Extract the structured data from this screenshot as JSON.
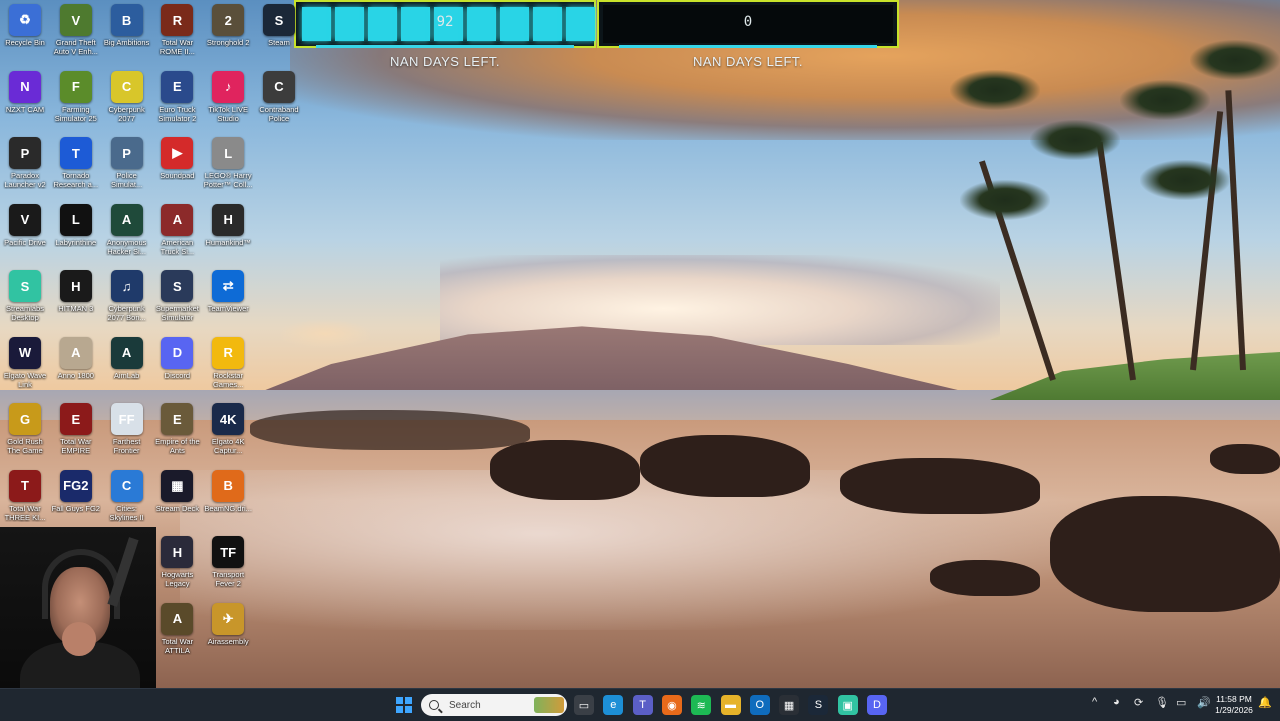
{
  "widgets": [
    {
      "value": "92",
      "label": "NAN DAYS LEFT.",
      "segments": 9
    },
    {
      "value": "0",
      "label": "NAN DAYS LEFT.",
      "segments": 0
    }
  ],
  "desktop_icons": [
    {
      "label": "Recycle Bin",
      "icon": "recycle-bin-icon",
      "color": "#3b6fd6",
      "glyph": "♻"
    },
    {
      "label": "Grand Theft Auto V Enh...",
      "icon": "gta-icon",
      "color": "#4e7a2f",
      "glyph": "V"
    },
    {
      "label": "Big Ambitions",
      "icon": "big-ambitions-icon",
      "color": "#2c5d9e",
      "glyph": "B"
    },
    {
      "label": "Total War ROME II...",
      "icon": "total-war-rome-icon",
      "color": "#7a2a1a",
      "glyph": "R"
    },
    {
      "label": "Stronghold 2",
      "icon": "stronghold-icon",
      "color": "#5a4f3a",
      "glyph": "2"
    },
    {
      "label": "Steam",
      "icon": "steam-icon",
      "color": "#1b2838",
      "glyph": "S"
    },
    {
      "label": "NZXT CAM",
      "icon": "nzxt-cam-icon",
      "color": "#6a2bd6",
      "glyph": "N"
    },
    {
      "label": "Farming Simulator 25",
      "icon": "farming-sim-icon",
      "color": "#5b8c2a",
      "glyph": "F"
    },
    {
      "label": "Cyberpunk 2077",
      "icon": "cyberpunk-icon",
      "color": "#d8c62a",
      "glyph": "C"
    },
    {
      "label": "Euro Truck Simulator 2",
      "icon": "euro-truck-icon",
      "color": "#2a4a8c",
      "glyph": "E"
    },
    {
      "label": "TikTok LIVE Studio",
      "icon": "tiktok-icon",
      "color": "#e0245e",
      "glyph": "♪"
    },
    {
      "label": "Contraband Police",
      "icon": "contraband-icon",
      "color": "#3c3c3c",
      "glyph": "C"
    },
    {
      "label": "Paradox Launcher v2",
      "icon": "paradox-icon",
      "color": "#2a2a2a",
      "glyph": "P"
    },
    {
      "label": "Tornado Research a...",
      "icon": "tornado-icon",
      "color": "#1d5bd6",
      "glyph": "T"
    },
    {
      "label": "Police Simulat...",
      "icon": "police-sim-icon",
      "color": "#4a6a8c",
      "glyph": "P"
    },
    {
      "label": "Soundpad",
      "icon": "soundpad-icon",
      "color": "#d42a2a",
      "glyph": "▶"
    },
    {
      "label": "LEGO® Harry Potter™ Coll...",
      "icon": "lego-hp-icon",
      "color": "#8a8a8a",
      "glyph": "L"
    },
    {
      "label": "Pacific Drive",
      "icon": "pacific-drive-icon",
      "color": "#1a1a1a",
      "glyph": "V"
    },
    {
      "label": "Labyrinthine",
      "icon": "labyrinthine-icon",
      "color": "#111111",
      "glyph": "L"
    },
    {
      "label": "Anonymous Hacker Si...",
      "icon": "hacker-sim-icon",
      "color": "#1f4a3a",
      "glyph": "A"
    },
    {
      "label": "American Truck Si...",
      "icon": "american-truck-icon",
      "color": "#8c2a2a",
      "glyph": "A"
    },
    {
      "label": "Humankind™",
      "icon": "humankind-icon",
      "color": "#2a2a2a",
      "glyph": "H"
    },
    {
      "label": "Streamlabs Desktop",
      "icon": "streamlabs-icon",
      "color": "#31c3a2",
      "glyph": "S"
    },
    {
      "label": "HITMAN 3",
      "icon": "hitman-icon",
      "color": "#1a1a1a",
      "glyph": "H"
    },
    {
      "label": "Cyberpunk 2077 Bon...",
      "icon": "cyberpunk-bonus-icon",
      "color": "#1f3a6a",
      "glyph": "♫"
    },
    {
      "label": "Supermarket Simulator",
      "icon": "supermarket-icon",
      "color": "#2a3a5a",
      "glyph": "S"
    },
    {
      "label": "TeamViewer",
      "icon": "teamviewer-icon",
      "color": "#0e6bd6",
      "glyph": "⇄"
    },
    {
      "label": "Elgato Wave Link",
      "icon": "elgato-wave-icon",
      "color": "#1a1a3a",
      "glyph": "W"
    },
    {
      "label": "Anno 1800",
      "icon": "anno-icon",
      "color": "#b8a890",
      "glyph": "A"
    },
    {
      "label": "AimLab",
      "icon": "aimlab-icon",
      "color": "#1a3a3a",
      "glyph": "A"
    },
    {
      "label": "Discord",
      "icon": "discord-icon",
      "color": "#5865f2",
      "glyph": "D"
    },
    {
      "label": "Rockstar Games...",
      "icon": "rockstar-icon",
      "color": "#f2b90e",
      "glyph": "R"
    },
    {
      "label": "Gold Rush The Game",
      "icon": "gold-rush-icon",
      "color": "#c89a1a",
      "glyph": "G"
    },
    {
      "label": "Total War EMPIRE",
      "icon": "total-war-empire-icon",
      "color": "#8c1a1a",
      "glyph": "E"
    },
    {
      "label": "Farthest Frontier",
      "icon": "farthest-frontier-icon",
      "color": "#d8e0e8",
      "glyph": "FF"
    },
    {
      "label": "Empire of the Ants",
      "icon": "empire-ants-icon",
      "color": "#6a5a3a",
      "glyph": "E"
    },
    {
      "label": "Elgato 4K Captur...",
      "icon": "elgato-4k-icon",
      "color": "#1a2a4a",
      "glyph": "4K"
    },
    {
      "label": "Total War THREE KI...",
      "icon": "total-war-three-kingdoms-icon",
      "color": "#8c1a1a",
      "glyph": "T"
    },
    {
      "label": "Fall Guys FG2",
      "icon": "fg2-icon",
      "color": "#1a2a6a",
      "glyph": "FG2"
    },
    {
      "label": "Cities: Skylines II",
      "icon": "cities-skylines-icon",
      "color": "#2a7ad6",
      "glyph": "C"
    },
    {
      "label": "Stream Deck",
      "icon": "stream-deck-icon",
      "color": "#1a1a2a",
      "glyph": "▦"
    },
    {
      "label": "BeamNG.dri...",
      "icon": "beamng-icon",
      "color": "#e06a1a",
      "glyph": "B"
    },
    {
      "label": "Hogwarts Legacy",
      "icon": "hogwarts-icon",
      "color": "#2a2a3a",
      "glyph": "H"
    },
    {
      "label": "Transport Fever 2",
      "icon": "transport-fever-icon",
      "color": "#111111",
      "glyph": "TF"
    },
    {
      "label": "Total War ATTILA",
      "icon": "total-war-attila-icon",
      "color": "#5a4a2a",
      "glyph": "A"
    },
    {
      "label": "Airassembly",
      "icon": "airassembly-icon",
      "color": "#c8962a",
      "glyph": "✈"
    }
  ],
  "taskbar": {
    "search_placeholder": "Search",
    "apps": [
      {
        "name": "task-view-icon",
        "color": "#3a3f46",
        "glyph": "▭"
      },
      {
        "name": "edge-icon",
        "color": "#1d8fd6",
        "glyph": "e"
      },
      {
        "name": "teams-icon",
        "color": "#5b5fc7",
        "glyph": "T"
      },
      {
        "name": "firefox-icon",
        "color": "#e86a1a",
        "glyph": "◉"
      },
      {
        "name": "spotify-icon",
        "color": "#1db954",
        "glyph": "≋"
      },
      {
        "name": "file-explorer-icon",
        "color": "#e6b32a",
        "glyph": "▬"
      },
      {
        "name": "outlook-icon",
        "color": "#0f6cbd",
        "glyph": "O"
      },
      {
        "name": "store-icon",
        "color": "#2a2f36",
        "glyph": "▦"
      },
      {
        "name": "steam-taskbar-icon",
        "color": "#1b2838",
        "glyph": "S"
      },
      {
        "name": "streamlabs-taskbar-icon",
        "color": "#31c3a2",
        "glyph": "▣"
      },
      {
        "name": "discord-taskbar-icon",
        "color": "#5865f2",
        "glyph": "D"
      }
    ],
    "tray": [
      "chevron-up-icon",
      "chrome-tray-icon",
      "update-icon",
      "microphone-icon",
      "network-icon",
      "volume-icon"
    ],
    "time": "11:58 PM",
    "date": "1/29/2026"
  }
}
